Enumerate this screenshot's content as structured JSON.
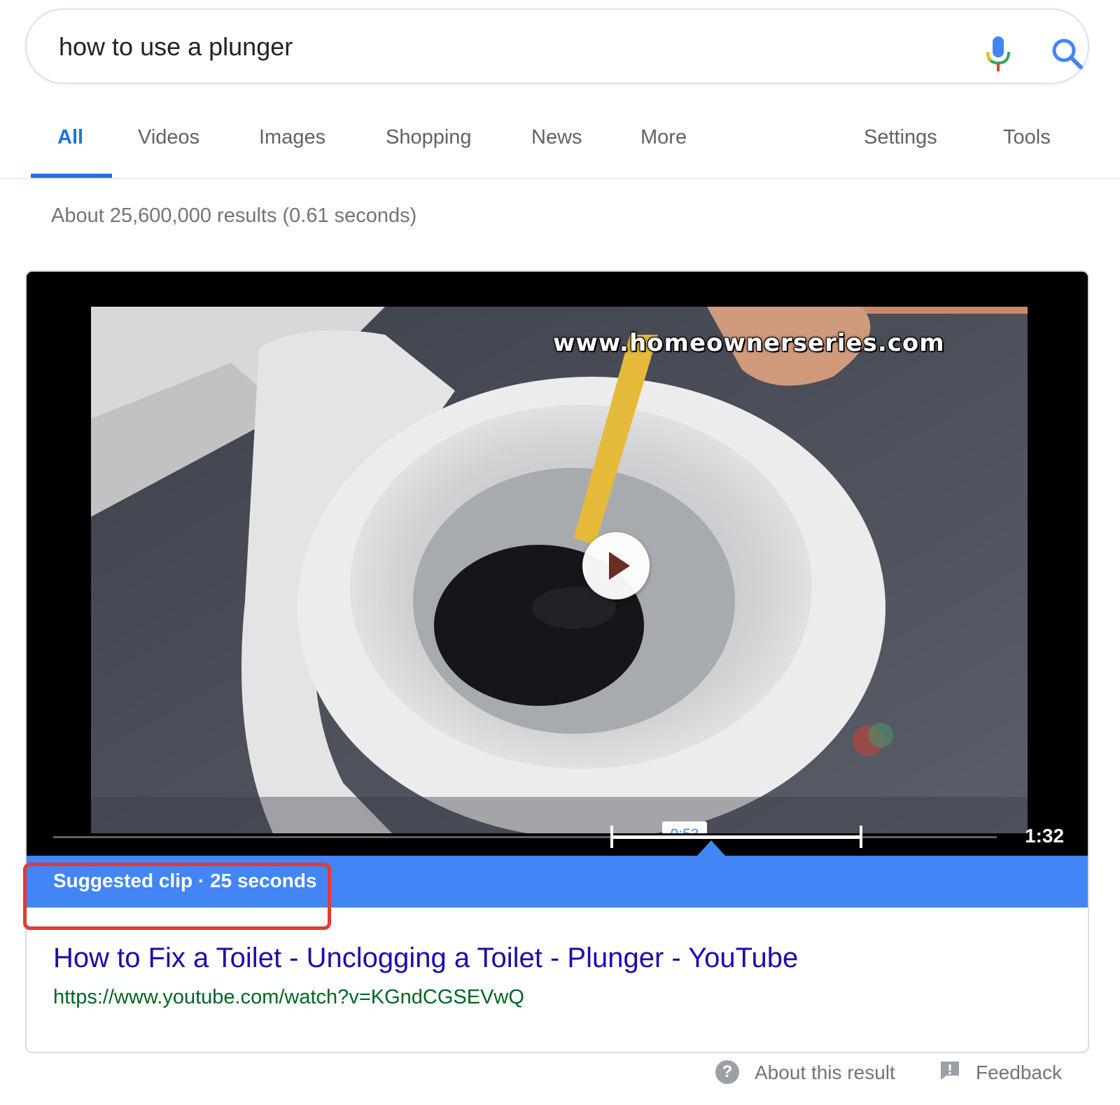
{
  "search": {
    "query": "how to use a plunger",
    "mic_icon": "microphone-icon",
    "search_icon": "magnifier-icon"
  },
  "tabs": [
    {
      "label": "All",
      "active": true
    },
    {
      "label": "Videos"
    },
    {
      "label": "Images"
    },
    {
      "label": "Shopping"
    },
    {
      "label": "News"
    },
    {
      "label": "More"
    },
    {
      "label": "Settings"
    },
    {
      "label": "Tools"
    }
  ],
  "result_stats": "About 25,600,000 results (0.61 seconds)",
  "video": {
    "watermark": "www.homeownerseries.com",
    "clip_start_label": "0:53",
    "duration": "1:32",
    "clip_start_fraction": 0.576,
    "clip_end_fraction": 0.842
  },
  "suggested_clip": "Suggested clip · 25 seconds",
  "result": {
    "title": "How to Fix a Toilet - Unclogging a Toilet - Plunger - YouTube",
    "url": "https://www.youtube.com/watch?v=KGndCGSEVwQ"
  },
  "footer": {
    "about": "About this result",
    "feedback": "Feedback",
    "about_icon": "question-circle-icon",
    "feedback_icon": "feedback-flag-icon"
  },
  "colors": {
    "accent_blue": "#1a73e8",
    "banner_blue": "#4285f4",
    "link": "#1a0dab",
    "url_green": "#006621",
    "highlight_red": "#e53935"
  }
}
